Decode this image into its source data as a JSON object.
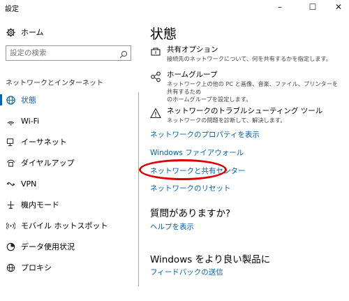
{
  "window": {
    "title": "設定",
    "minimize": "–",
    "maximize": "☐",
    "close": "✕"
  },
  "sidebar": {
    "home_label": "ホーム",
    "search_placeholder": "設定の検索",
    "section_header": "ネットワークとインターネット",
    "items": [
      {
        "label": "状態",
        "icon": "network-status-icon",
        "active": true
      },
      {
        "label": "Wi-Fi",
        "icon": "wifi-icon"
      },
      {
        "label": "イーサネット",
        "icon": "ethernet-icon"
      },
      {
        "label": "ダイヤルアップ",
        "icon": "dialup-icon"
      },
      {
        "label": "VPN",
        "icon": "vpn-icon"
      },
      {
        "label": "機内モード",
        "icon": "airplane-icon"
      },
      {
        "label": "モバイル ホットスポット",
        "icon": "hotspot-icon"
      },
      {
        "label": "データ使用状況",
        "icon": "data-usage-icon"
      },
      {
        "label": "プロキシ",
        "icon": "proxy-icon"
      }
    ]
  },
  "main": {
    "title": "状態",
    "options": [
      {
        "title": "共有オプション",
        "desc": [
          "接続先のネットワークについて、何を共有するかを指定します。"
        ],
        "icon": "sharing-icon"
      },
      {
        "title": "ホームグループ",
        "desc": [
          "ネットワーク上の他の PC と画像、音楽、ファイル、プリンターを共有するため",
          "のホームグループを設定します。"
        ],
        "icon": "homegroup-icon"
      },
      {
        "title": "ネットワークのトラブルシューティング ツール",
        "desc": [
          "ネットワークの問題を診断して、解決します。"
        ],
        "icon": "warning-icon"
      }
    ],
    "links": {
      "properties": "ネットワークのプロパティを表示",
      "firewall": "Windows ファイアウォール",
      "sharing_center": "ネットワークと共有センター",
      "reset": "ネットワークのリセット"
    },
    "questions": {
      "title": "質問がありますか?",
      "help": "ヘルプを表示"
    },
    "better": {
      "title": "Windows をより良い製品に",
      "feedback": "フィードバックの送信"
    }
  },
  "colors": {
    "accent": "#0063b1",
    "highlight": "#e00000"
  }
}
